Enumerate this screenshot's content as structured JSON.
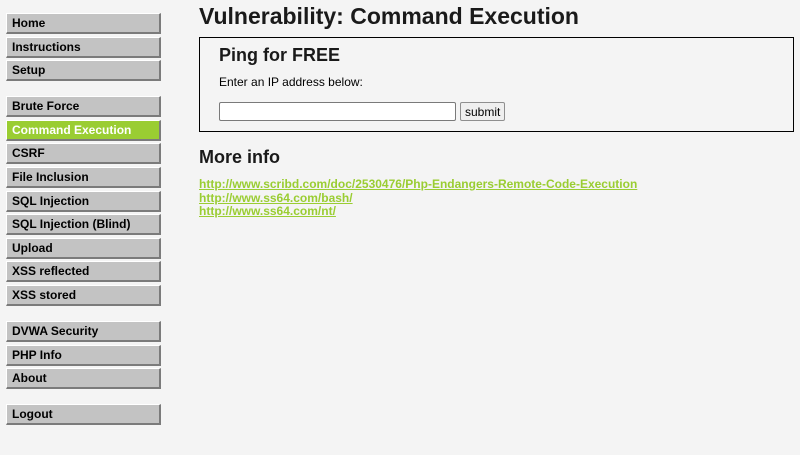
{
  "sidebar": {
    "groups": [
      {
        "items": [
          {
            "label": "Home"
          },
          {
            "label": "Instructions"
          },
          {
            "label": "Setup"
          }
        ]
      },
      {
        "items": [
          {
            "label": "Brute Force"
          },
          {
            "label": "Command Execution"
          },
          {
            "label": "CSRF"
          },
          {
            "label": "File Inclusion"
          },
          {
            "label": "SQL Injection"
          },
          {
            "label": "SQL Injection (Blind)"
          },
          {
            "label": "Upload"
          },
          {
            "label": "XSS reflected"
          },
          {
            "label": "XSS stored"
          }
        ]
      },
      {
        "items": [
          {
            "label": "DVWA Security"
          },
          {
            "label": "PHP Info"
          },
          {
            "label": "About"
          }
        ]
      },
      {
        "items": [
          {
            "label": "Logout"
          }
        ]
      }
    ],
    "selected_item": "Command Execution"
  },
  "main": {
    "title": "Vulnerability: Command Execution",
    "box": {
      "title": "Ping for FREE",
      "prompt": "Enter an IP address below:",
      "ip_value": "",
      "submit_label": "submit"
    },
    "more_info": {
      "heading": "More info",
      "links": [
        "http://www.scribd.com/doc/2530476/Php-Endangers-Remote-Code-Execution",
        "http://www.ss64.com/bash/",
        "http://www.ss64.com/nt/"
      ]
    }
  },
  "colors": {
    "accent": "#9acd32",
    "menu_bg": "#c3c3c3",
    "page_bg": "#f4f4f4"
  }
}
